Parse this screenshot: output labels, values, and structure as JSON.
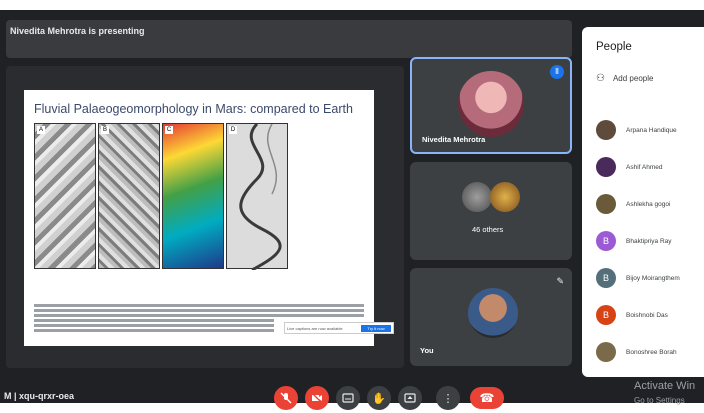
{
  "presenting_banner": "Nivedita Mehrotra is presenting",
  "slide": {
    "title": "Fluvial Palaeogeomorphology in Mars: compared to Earth",
    "panel_labels": [
      "A",
      "B",
      "C",
      "D"
    ],
    "subtitle_bar_text": "Live captions are now available",
    "subtitle_bar_button": "Try it now"
  },
  "tiles": {
    "presenter_name": "Nivedita Mehrotra",
    "others_label": "46 others",
    "self_label": "You"
  },
  "people_panel": {
    "title": "People",
    "add_people_label": "Add people",
    "participants": [
      {
        "name": "Arpana Handique",
        "initial": "",
        "color": "#5f4b3b"
      },
      {
        "name": "Ashif Ahmed",
        "initial": "",
        "color": "#4a2a5a"
      },
      {
        "name": "Ashlekha gogoi",
        "initial": "",
        "color": "#6b5a3a"
      },
      {
        "name": "Bhaktipriya Ray",
        "initial": "B",
        "color": "#9c5bd5"
      },
      {
        "name": "Bijoy Moirangthem",
        "initial": "B",
        "color": "#546e7a"
      },
      {
        "name": "Boishnobi Das",
        "initial": "B",
        "color": "#d84315"
      },
      {
        "name": "Bonoshree Borah",
        "initial": "",
        "color": "#7a6a4a"
      }
    ]
  },
  "bottom_bar": {
    "meeting_code": "M  |  xqu-qrxr-oea",
    "activate_windows": "Activate Win",
    "go_to_settings": "Go to Settings"
  },
  "controls": {
    "mic": "mic-off-icon",
    "camera": "camera-off-icon",
    "captions": "captions-icon",
    "hand": "raise-hand-icon",
    "present": "present-icon",
    "more": "more-options-icon",
    "end_call": "end-call-icon"
  }
}
